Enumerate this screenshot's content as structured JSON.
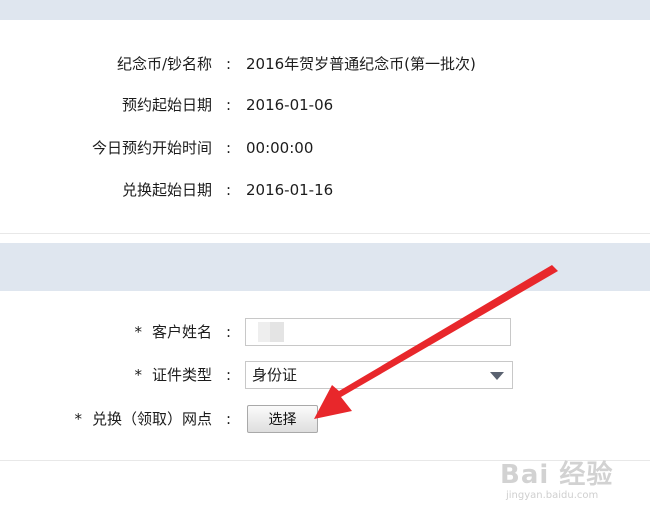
{
  "coin_info": {
    "name_label": "纪念币/钞名称",
    "name_value": "2016年贺岁普通纪念币(第一批次)",
    "reserve_start_label": "预约起始日期",
    "reserve_start_value": "2016-01-06",
    "today_open_label": "今日预约开始时间",
    "today_open_value": "00:00:00",
    "exchange_start_label": "兑换起始日期",
    "exchange_start_value": "2016-01-16",
    "colon": ":"
  },
  "form": {
    "required_mark": "*",
    "customer_name_label": "客户姓名",
    "customer_name_value": "",
    "id_type_label": "证件类型",
    "id_type_value": "身份证",
    "branch_label": "兑换（领取）网点",
    "choose_button": "选择"
  },
  "annotation": {
    "arrow_color": "#e8272b"
  },
  "watermark": {
    "brand": "Bai 经验",
    "site": "jingyan.baidu.com"
  }
}
